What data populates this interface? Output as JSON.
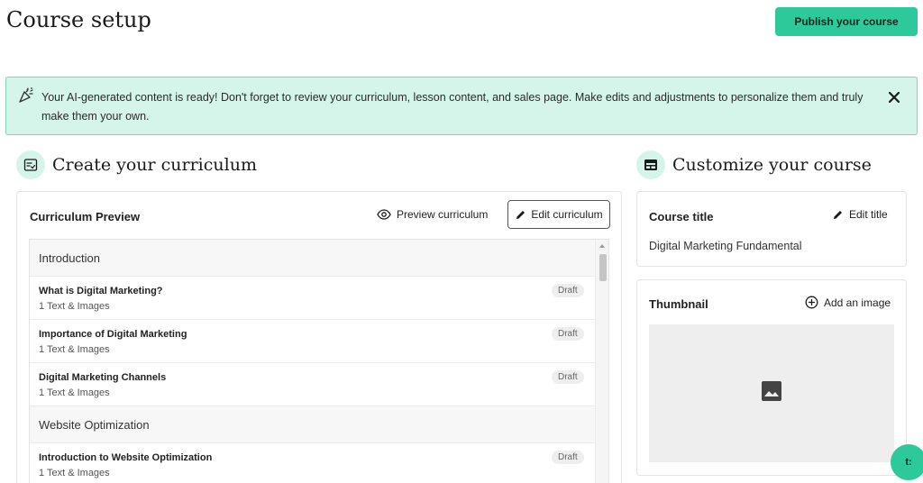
{
  "header": {
    "title": "Course setup",
    "publish_label": "Publish your course"
  },
  "alert": {
    "message": "Your AI-generated content is ready! Don't forget to review your curriculum, lesson content, and sales page. Make edits and adjustments to personalize them and truly make them your own."
  },
  "curriculum": {
    "section_title": "Create your curriculum",
    "card_title": "Curriculum Preview",
    "preview_label": "Preview curriculum",
    "edit_label": "Edit curriculum",
    "chapters": [
      {
        "title": "Introduction",
        "lessons": [
          {
            "title": "What is Digital Marketing?",
            "meta": "1 Text & Images",
            "status": "Draft"
          },
          {
            "title": "Importance of Digital Marketing",
            "meta": "1 Text & Images",
            "status": "Draft"
          },
          {
            "title": "Digital Marketing Channels",
            "meta": "1 Text & Images",
            "status": "Draft"
          }
        ]
      },
      {
        "title": "Website Optimization",
        "lessons": [
          {
            "title": "Introduction to Website Optimization",
            "meta": "1 Text & Images",
            "status": "Draft"
          }
        ]
      }
    ]
  },
  "customize": {
    "section_title": "Customize your course",
    "course_title_label": "Course title",
    "edit_title_label": "Edit title",
    "course_title_value": "Digital Marketing Fundamental",
    "thumbnail_label": "Thumbnail",
    "add_image_label": "Add an image"
  },
  "chat": {
    "label": "t:"
  },
  "colors": {
    "accent": "#2ec99a",
    "alert_bg": "#d6f5ea",
    "alert_border": "#7fd6b4"
  }
}
